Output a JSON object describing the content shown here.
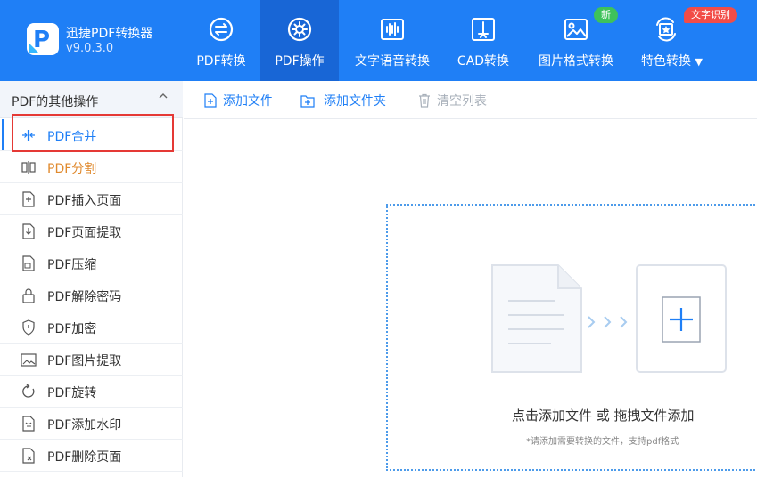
{
  "app": {
    "name": "迅捷PDF转换器",
    "version": "v9.0.3.0"
  },
  "nav": [
    {
      "label": "PDF转换",
      "icon": "convert-icon"
    },
    {
      "label": "PDF操作",
      "icon": "gear-icon"
    },
    {
      "label": "文字语音转换",
      "icon": "audio-wave-icon"
    },
    {
      "label": "CAD转换",
      "icon": "cad-icon"
    },
    {
      "label": "图片格式转换",
      "icon": "image-icon"
    },
    {
      "label": "特色转换",
      "icon": "special-convert-icon"
    }
  ],
  "badges": {
    "new": "新",
    "ocr": "文字识别"
  },
  "sidebar": {
    "title": "PDF的其他操作",
    "items": [
      {
        "label": "PDF合并",
        "icon": "merge-icon"
      },
      {
        "label": "PDF分割",
        "icon": "split-icon"
      },
      {
        "label": "PDF插入页面",
        "icon": "insert-page-icon"
      },
      {
        "label": "PDF页面提取",
        "icon": "extract-page-icon"
      },
      {
        "label": "PDF压缩",
        "icon": "compress-icon"
      },
      {
        "label": "PDF解除密码",
        "icon": "unlock-icon"
      },
      {
        "label": "PDF加密",
        "icon": "shield-icon"
      },
      {
        "label": "PDF图片提取",
        "icon": "image-extract-icon"
      },
      {
        "label": "PDF旋转",
        "icon": "rotate-icon"
      },
      {
        "label": "PDF添加水印",
        "icon": "watermark-icon"
      },
      {
        "label": "PDF删除页面",
        "icon": "delete-page-icon"
      }
    ]
  },
  "toolbar": {
    "add_file": "添加文件",
    "add_folder": "添加文件夹",
    "clear_list": "清空列表"
  },
  "dropzone": {
    "title": "点击添加文件 或 拖拽文件添加",
    "hint": "*请添加需要转换的文件，支持pdf格式"
  },
  "colors": {
    "primary": "#1f7ff6",
    "active_tab": "#1866d6",
    "highlight": "#e53935",
    "hover_text": "#e08a2e"
  }
}
